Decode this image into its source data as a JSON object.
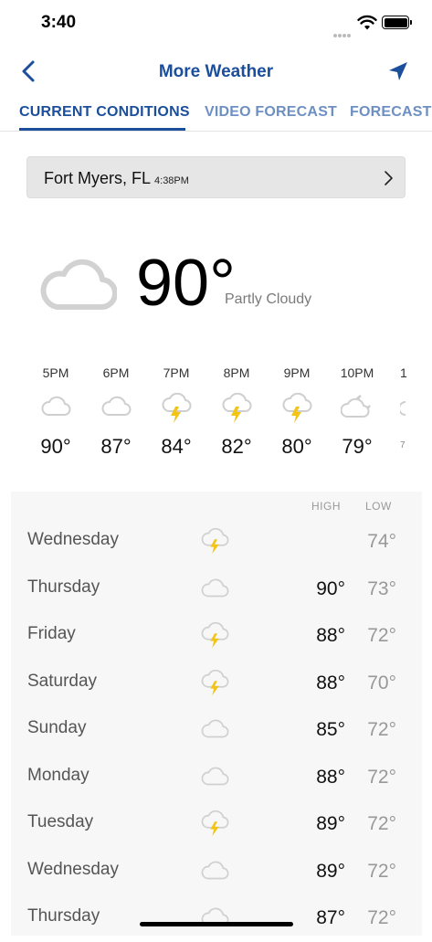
{
  "status": {
    "time": "3:40"
  },
  "nav": {
    "title": "More Weather"
  },
  "tabs": [
    {
      "label": "CURRENT CONDITIONS",
      "active": true
    },
    {
      "label": "VIDEO FORECAST",
      "active": false
    },
    {
      "label": "FORECAST C",
      "active": false
    }
  ],
  "location": {
    "city": "Fort Myers, FL",
    "time": "4:38PM"
  },
  "current": {
    "temp": "90°",
    "condition": "Partly Cloudy",
    "icon": "cloud-icon"
  },
  "hourly": [
    {
      "time": "5PM",
      "temp": "90°",
      "icon": "cloud-icon"
    },
    {
      "time": "6PM",
      "temp": "87°",
      "icon": "cloud-icon"
    },
    {
      "time": "7PM",
      "temp": "84°",
      "icon": "thunderstorm-icon"
    },
    {
      "time": "8PM",
      "temp": "82°",
      "icon": "thunderstorm-icon"
    },
    {
      "time": "9PM",
      "temp": "80°",
      "icon": "thunderstorm-icon"
    },
    {
      "time": "10PM",
      "temp": "79°",
      "icon": "partly-cloudy-night-icon"
    },
    {
      "time": "1",
      "temp": "7",
      "icon": "cloud-icon"
    }
  ],
  "daily_header": {
    "high": "HIGH",
    "low": "LOW"
  },
  "daily": [
    {
      "day": "Wednesday",
      "high": "",
      "low": "74°",
      "icon": "thunderstorm-icon"
    },
    {
      "day": "Thursday",
      "high": "90°",
      "low": "73°",
      "icon": "cloud-icon"
    },
    {
      "day": "Friday",
      "high": "88°",
      "low": "72°",
      "icon": "thunderstorm-icon"
    },
    {
      "day": "Saturday",
      "high": "88°",
      "low": "70°",
      "icon": "thunderstorm-icon"
    },
    {
      "day": "Sunday",
      "high": "85°",
      "low": "72°",
      "icon": "cloud-icon"
    },
    {
      "day": "Monday",
      "high": "88°",
      "low": "72°",
      "icon": "cloud-icon"
    },
    {
      "day": "Tuesday",
      "high": "89°",
      "low": "72°",
      "icon": "thunderstorm-icon"
    },
    {
      "day": "Wednesday",
      "high": "89°",
      "low": "72°",
      "icon": "cloud-icon"
    },
    {
      "day": "Thursday",
      "high": "87°",
      "low": "72°",
      "icon": "cloud-icon"
    }
  ],
  "colors": {
    "accent": "#1b4e9b",
    "tab_inactive": "#6e8fc2",
    "bolt": "#f2c418",
    "cloud": "#c9c9c9"
  }
}
